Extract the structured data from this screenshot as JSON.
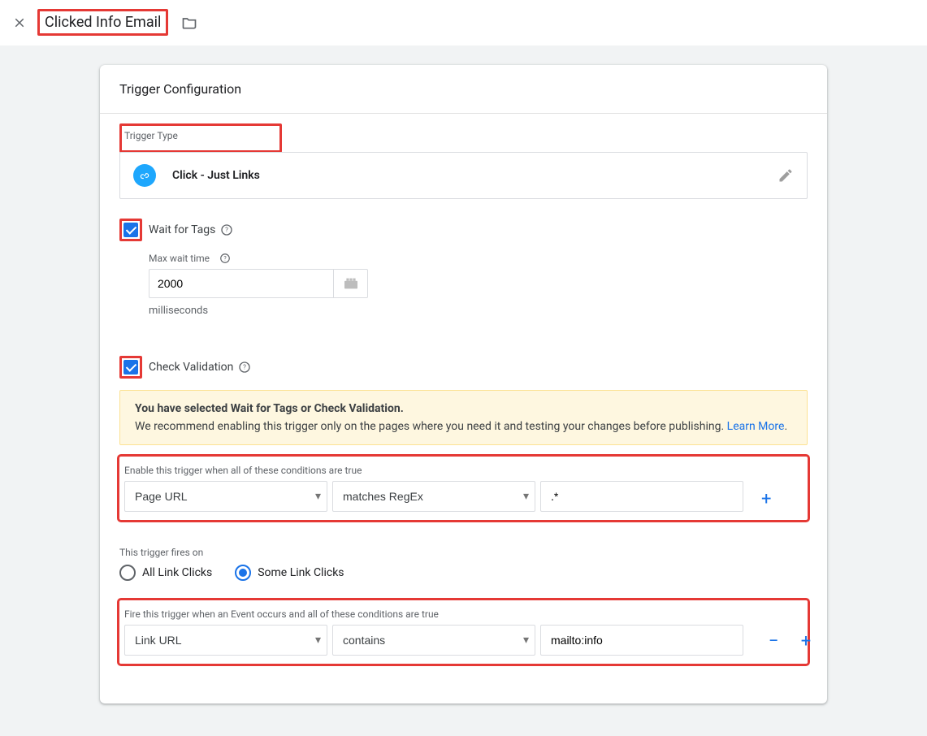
{
  "header": {
    "title": "Clicked Info Email"
  },
  "card": {
    "title": "Trigger Configuration",
    "trigger_type_label": "Trigger Type",
    "trigger_type_name": "Click - Just Links",
    "wait_for_tags": {
      "label": "Wait for Tags",
      "checked": true,
      "max_label": "Max wait time",
      "max_value": "2000",
      "unit": "milliseconds"
    },
    "check_validation": {
      "label": "Check Validation",
      "checked": true
    },
    "warning": {
      "bold": "You have selected Wait for Tags or Check Validation.",
      "text": "We recommend enabling this trigger only on the pages where you need it and testing your changes before publishing. ",
      "link": "Learn More"
    },
    "enable_cond": {
      "label": "Enable this trigger when all of these conditions are true",
      "var": "Page URL",
      "op": "matches RegEx",
      "val": ".*"
    },
    "fires_on": {
      "label": "This trigger fires on",
      "all": "All Link Clicks",
      "some": "Some Link Clicks",
      "selected": "some"
    },
    "fire_cond": {
      "label": "Fire this trigger when an Event occurs and all of these conditions are true",
      "var": "Link URL",
      "op": "contains",
      "val": "mailto:info"
    }
  }
}
